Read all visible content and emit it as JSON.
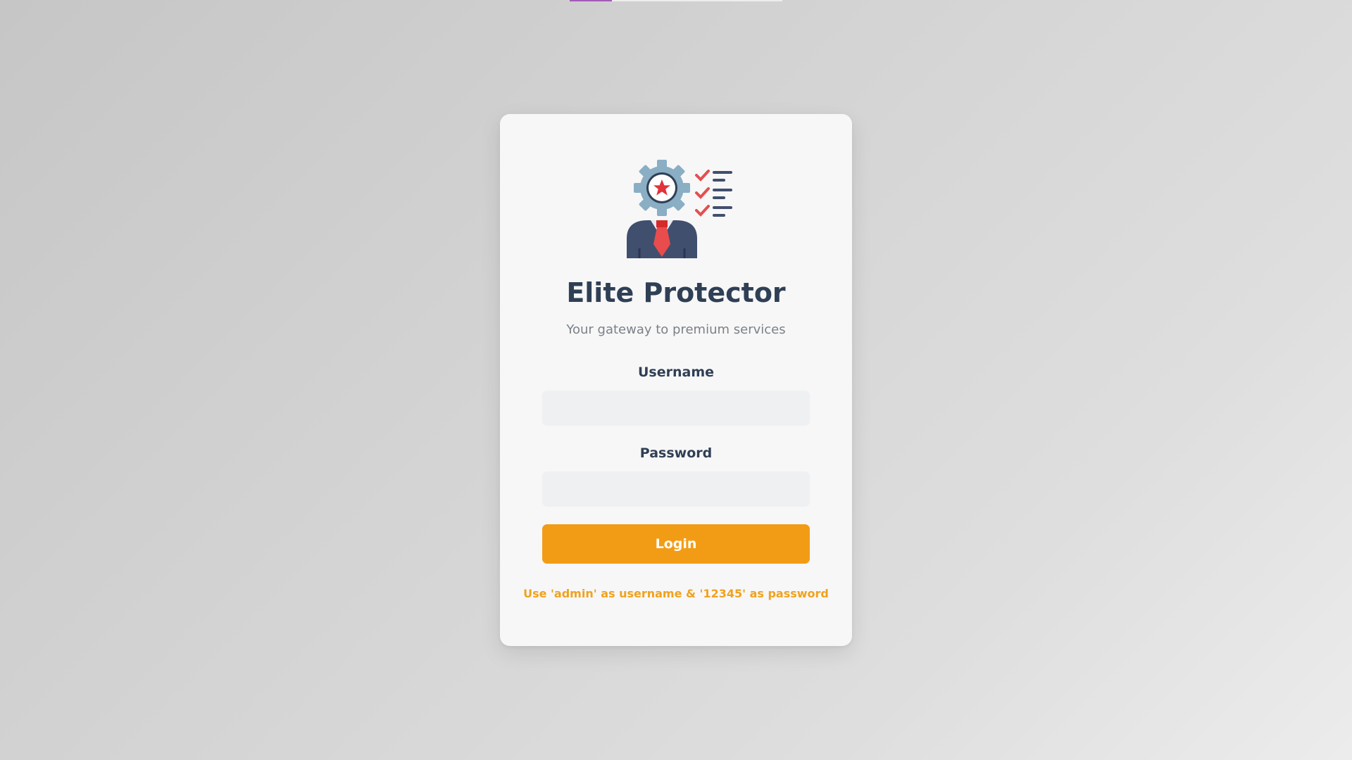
{
  "page": {
    "top_loading_progress": 0.2
  },
  "login": {
    "title": "Elite Protector",
    "subtitle": "Your gateway to premium services",
    "username_label": "Username",
    "username_value": "",
    "password_label": "Password",
    "password_value": "",
    "login_button": "Login",
    "hint": "Use 'admin' as username & '12345' as password",
    "logo_icon": "security-agent-checklist-icon"
  },
  "colors": {
    "accent": "#f29c16",
    "title": "#2f3f55",
    "subtitle": "#7b8189",
    "card_background": "#f7f7f7",
    "input_background": "#eef0f1",
    "loading_bar": "#a25bb5"
  }
}
